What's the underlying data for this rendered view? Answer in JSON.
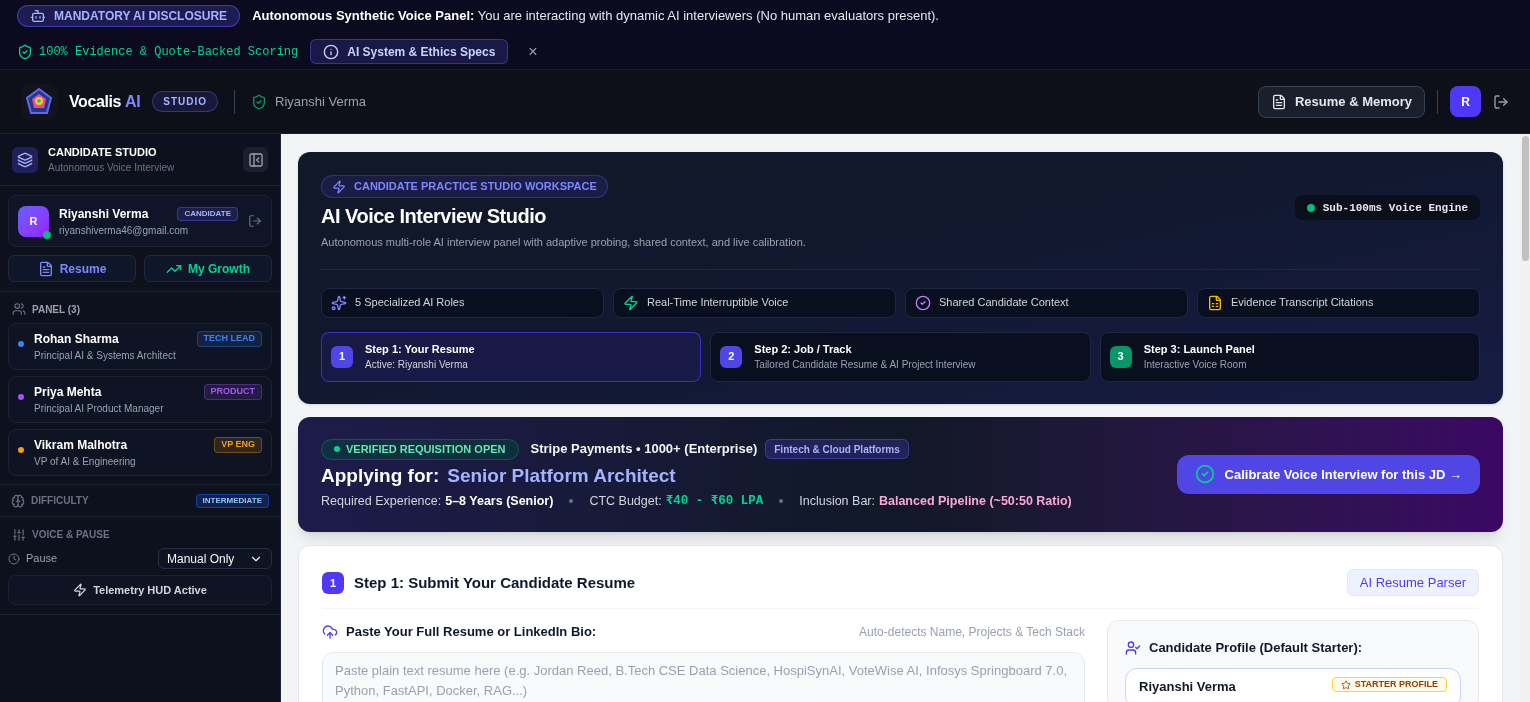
{
  "disclosure": {
    "badge": "MANDATORY AI DISCLOSURE",
    "message": "**Autonomous Synthetic Voice Panel:** You are interacting with dynamic AI interviewers (No human evaluators present).",
    "scoring": "100% Evidence & Quote-Backed Scoring",
    "specs_button": "AI System & Ethics Specs",
    "close": "×"
  },
  "header": {
    "brand": "Vocalis",
    "brand_suffix": "AI",
    "edition": "STUDIO",
    "user": "Riyanshi Verma",
    "resume_button": "Resume & Memory",
    "avatar": "R"
  },
  "sidebar": {
    "title": "CANDIDATE STUDIO",
    "subtitle": "Autonomous Voice Interview",
    "profile": {
      "avatar": "R",
      "name": "Riyanshi Verma",
      "role": "CANDIDATE",
      "email": "riyanshiverma46@gmail.com",
      "online": true
    },
    "buttons": [
      {
        "label": "Resume",
        "kind": "resume"
      },
      {
        "label": "My Growth",
        "kind": "growth"
      }
    ],
    "panel_label": "PANEL (3)",
    "panel": [
      {
        "name": "Rohan Sharma",
        "title": "Principal AI & Systems Architect",
        "tag": "TECH LEAD",
        "color": "#3b82f6"
      },
      {
        "name": "Priya Mehta",
        "title": "Principal AI Product Manager",
        "tag": "PRODUCT",
        "color": "#a855f7"
      },
      {
        "name": "Vikram Malhotra",
        "title": "VP of AI & Engineering",
        "tag": "VP ENG",
        "color": "#f59e0b"
      }
    ],
    "difficulty_label": "DIFFICULTY",
    "difficulty": "INTERMEDIATE",
    "voice_label": "VOICE & PAUSE",
    "pause_label": "Pause",
    "pause_value": "Manual Only",
    "telemetry": "Telemetry HUD Active"
  },
  "hero": {
    "eyebrow": "CANDIDATE PRACTICE STUDIO WORKSPACE",
    "title": "AI Voice Interview Studio",
    "subtitle": "Autonomous multi-role AI interview panel with adaptive probing, shared context, and live calibration.",
    "engine": "Sub-100ms Voice Engine",
    "features": [
      {
        "label": "5 Specialized AI Roles",
        "kind": "sparkles"
      },
      {
        "label": "Real-Time Interruptible Voice",
        "kind": "zap"
      },
      {
        "label": "Shared Candidate Context",
        "kind": "check"
      },
      {
        "label": "Evidence Transcript Citations",
        "kind": "file"
      }
    ],
    "steps": [
      {
        "number": "1",
        "title": "Step 1: Your Resume",
        "detail": "Active: Riyanshi Verma",
        "selected": true,
        "color": "#4f46e5"
      },
      {
        "number": "2",
        "title": "Step 2: Job / Track",
        "detail": "Tailored Candidate Resume & AI Project Interview",
        "selected": false,
        "color": "#4f46e5"
      },
      {
        "number": "3",
        "title": "Step 3: Launch Panel",
        "detail": "Interactive Voice Room",
        "selected": false,
        "color": "#059669"
      }
    ]
  },
  "job": {
    "status": "VERIFIED REQUISITION OPEN",
    "company": "Stripe Payments • 1000+ (Enterprise)",
    "sector": "Fintech & Cloud Platforms",
    "applying_label": "Applying for:",
    "role": "Senior Platform Architect",
    "facts": [
      {
        "label": "Required Experience:",
        "value": "5–8 Years (Senior)",
        "kind": "plain"
      },
      {
        "label": "CTC Budget:",
        "value": "₹40 - ₹60 LPA",
        "kind": "money"
      },
      {
        "label": "Inclusion Bar:",
        "value": "Balanced Pipeline (~50:50 Ratio)",
        "kind": "highlight"
      }
    ],
    "cta": "Calibrate Voice Interview for this JD →"
  },
  "resume_step": {
    "number": "1",
    "title": "Step 1: Submit Your Candidate Resume",
    "parser": "AI Resume Parser",
    "paste_label": "Paste Your Full Resume or LinkedIn Bio:",
    "hint": "Auto-detects Name, Projects & Tech Stack",
    "placeholder": "Paste plain text resume here (e.g. Jordan Reed, B.Tech CSE Data Science, HospiSynAI, VoteWise AI, Infosys Springboard 7.0, Python, FastAPI, Docker, RAG...)",
    "profile_title": "Candidate Profile (Default Starter):",
    "profile_name": "Riyanshi Verma",
    "profile_badge": "STARTER PROFILE"
  }
}
